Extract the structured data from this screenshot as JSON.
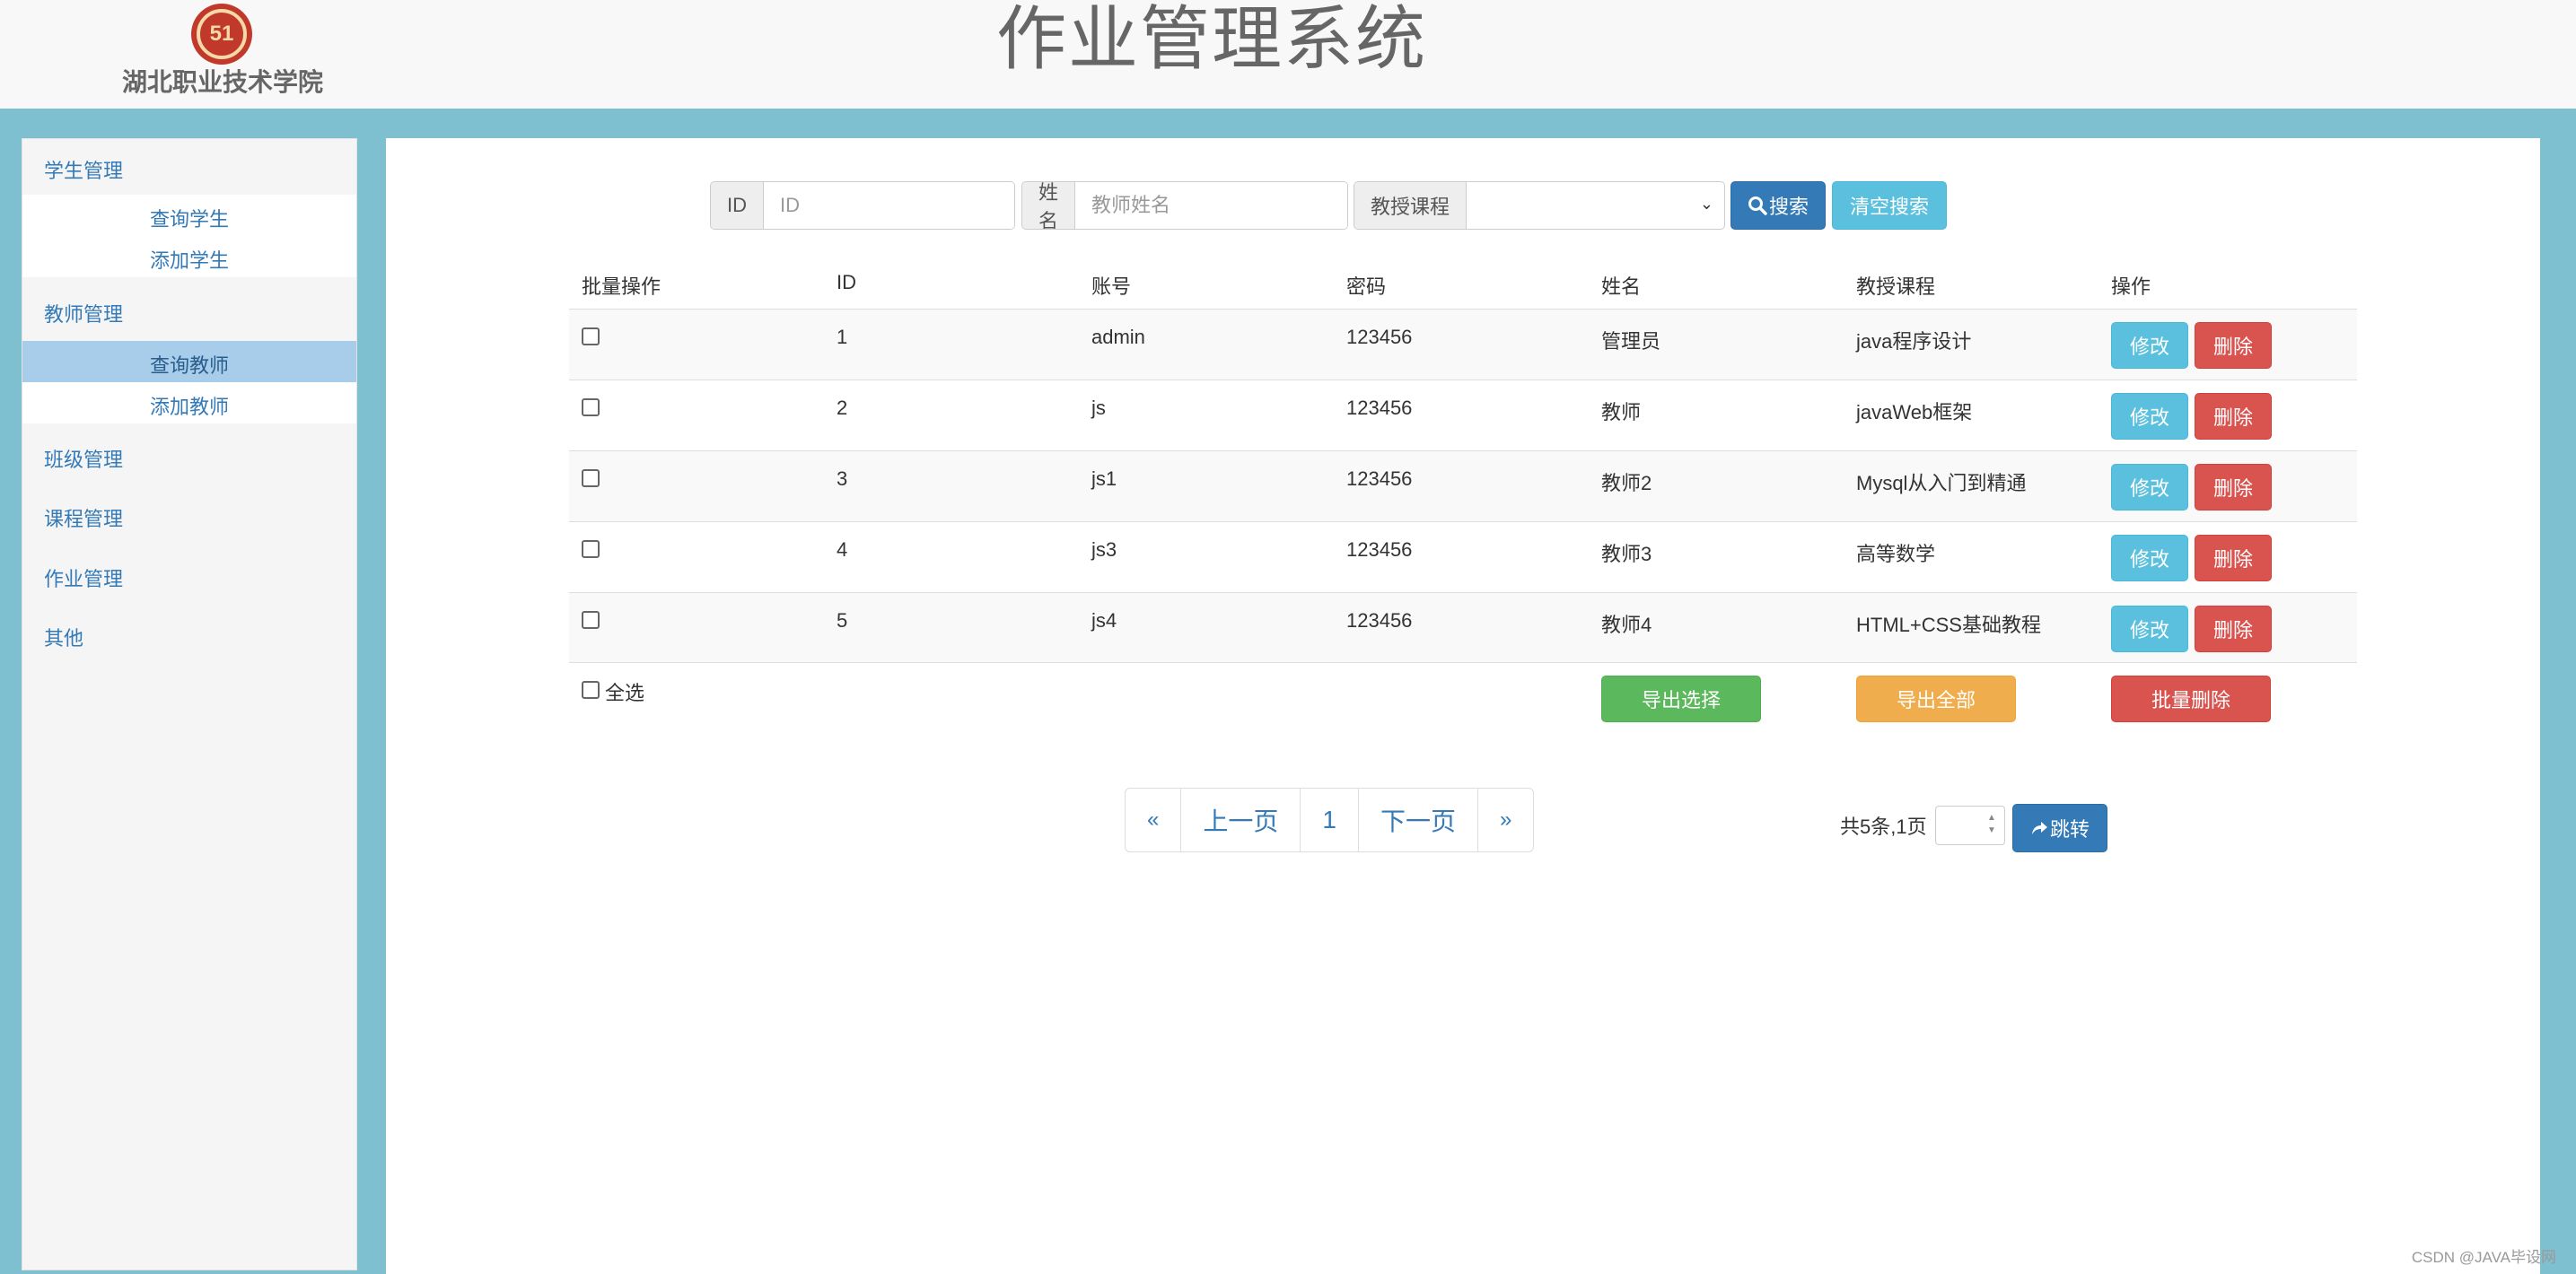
{
  "header": {
    "logo_mark": "51",
    "school_name": "湖北职业技术学院",
    "system_title": "作业管理系统"
  },
  "sidebar": {
    "groups": [
      {
        "label": "学生管理",
        "items": [
          {
            "label": "查询学生"
          },
          {
            "label": "添加学生"
          }
        ]
      },
      {
        "label": "教师管理",
        "items": [
          {
            "label": "查询教师",
            "active": true
          },
          {
            "label": "添加教师"
          }
        ]
      },
      {
        "label": "班级管理"
      },
      {
        "label": "课程管理"
      },
      {
        "label": "作业管理"
      },
      {
        "label": "其他"
      }
    ]
  },
  "search": {
    "id_label": "ID",
    "id_placeholder": "ID",
    "name_label": "姓名",
    "name_placeholder": "教师姓名",
    "course_label": "教授课程",
    "course_value": "",
    "search_button": "搜索",
    "clear_button": "清空搜索"
  },
  "table": {
    "headers": [
      "批量操作",
      "ID",
      "账号",
      "密码",
      "姓名",
      "教授课程",
      "操作"
    ],
    "rows": [
      {
        "id": "1",
        "account": "admin",
        "password": "123456",
        "name": "管理员",
        "course": "java程序设计"
      },
      {
        "id": "2",
        "account": "js",
        "password": "123456",
        "name": "教师",
        "course": "javaWeb框架"
      },
      {
        "id": "3",
        "account": "js1",
        "password": "123456",
        "name": "教师2",
        "course": "Mysql从入门到精通"
      },
      {
        "id": "4",
        "account": "js3",
        "password": "123456",
        "name": "教师3",
        "course": "高等数学"
      },
      {
        "id": "5",
        "account": "js4",
        "password": "123456",
        "name": "教师4",
        "course": "HTML+CSS基础教程"
      }
    ],
    "edit_label": "修改",
    "delete_label": "删除",
    "select_all_label": "全选",
    "export_selected": "导出选择",
    "export_all": "导出全部",
    "batch_delete": "批量删除"
  },
  "pagination": {
    "first": "«",
    "prev": "上一页",
    "current": "1",
    "next": "下一页",
    "last": "»",
    "total_text": "共5条,1页",
    "jump_button": "跳转"
  },
  "watermark": "CSDN @JAVA毕设网",
  "colors": {
    "primary": "#337ab7",
    "info": "#5bc0de",
    "danger": "#d9534f",
    "success": "#5cb85c",
    "warning": "#f0ad4e",
    "page_bg": "#7fc0d0"
  }
}
